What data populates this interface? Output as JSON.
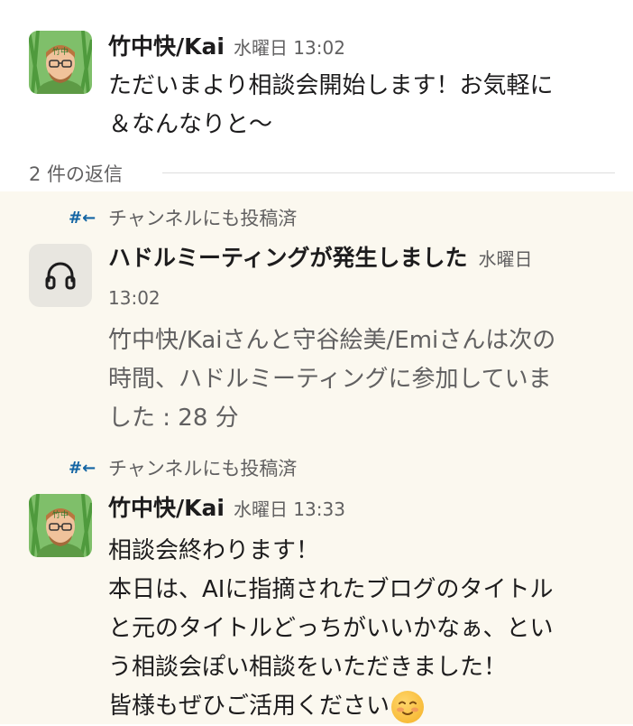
{
  "message1": {
    "author": "竹中快/Kai",
    "time": "水曜日 13:02",
    "line1": "ただいまより相談会開始します！お気軽に",
    "line2": "＆なんなりと〜"
  },
  "thread": {
    "reply_count": "2 件の返信"
  },
  "reply1": {
    "posted_label": "チャンネルにも投稿済",
    "title": "ハドルミーティングが発生しました",
    "time_a": "水曜日",
    "time_b": "13:02",
    "line1": "竹中快/Kaiさんと守谷絵美/Emiさんは次の",
    "line2": "時間、ハドルミーティングに参加していま",
    "line3": "した : 28 分"
  },
  "reply2": {
    "posted_label": "チャンネルにも投稿済",
    "author": "竹中快/Kai",
    "time": "水曜日 13:33",
    "line1": "相談会終わります！",
    "line2": "本日は、AIに指摘されたブログのタイトル",
    "line3": "と元のタイトルどっちがいいかなぁ、とい",
    "line4": "う相談会ぽい相談をいただきました！",
    "line5": "皆様もぜひご活用ください"
  },
  "icons": [
    "avatar",
    "channel-hash-icon",
    "headphones-icon",
    "relieved-emoji-icon"
  ]
}
